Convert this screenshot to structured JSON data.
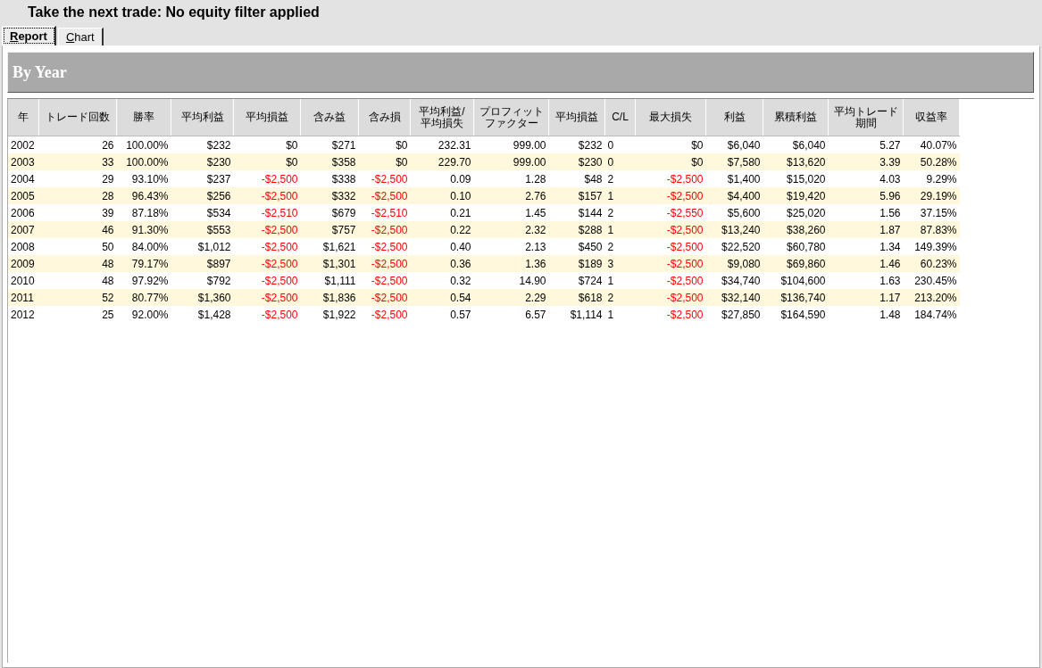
{
  "title": "Take the next trade: No equity filter applied",
  "tabs": [
    {
      "label": "Report",
      "selected": true
    },
    {
      "label": "Chart",
      "selected": false
    }
  ],
  "section_title": "By Year",
  "table": {
    "columns": [
      {
        "label": "年",
        "kind": "text"
      },
      {
        "label": "トレード回数",
        "kind": "number"
      },
      {
        "label": "勝率",
        "kind": "number"
      },
      {
        "label": "平均利益",
        "kind": "number"
      },
      {
        "label": "平均損益",
        "kind": "number"
      },
      {
        "label": "含み益",
        "kind": "number"
      },
      {
        "label": "含み損",
        "kind": "number"
      },
      {
        "label": "平均利益/平均損失",
        "kind": "number"
      },
      {
        "label": "プロフィットファクター",
        "kind": "number"
      },
      {
        "label": "平均損益",
        "kind": "number"
      },
      {
        "label": "C/L",
        "kind": "text"
      },
      {
        "label": "最大損失",
        "kind": "number"
      },
      {
        "label": "利益",
        "kind": "number"
      },
      {
        "label": "累積利益",
        "kind": "number"
      },
      {
        "label": "平均トレード期間",
        "kind": "number"
      },
      {
        "label": "収益率",
        "kind": "number"
      }
    ],
    "rows": [
      {
        "cells": [
          {
            "text": "2002",
            "loss": false
          },
          {
            "text": "26",
            "loss": false
          },
          {
            "text": "100.00%",
            "loss": false
          },
          {
            "text": "$232",
            "loss": false
          },
          {
            "text": "$0",
            "loss": false
          },
          {
            "text": "$271",
            "loss": false
          },
          {
            "text": "$0",
            "loss": false
          },
          {
            "text": "232.31",
            "loss": false
          },
          {
            "text": "999.00",
            "loss": false
          },
          {
            "text": "$232",
            "loss": false
          },
          {
            "text": "0",
            "loss": false
          },
          {
            "text": "$0",
            "loss": false
          },
          {
            "text": "$6,040",
            "loss": false
          },
          {
            "text": "$6,040",
            "loss": false
          },
          {
            "text": "5.27",
            "loss": false
          },
          {
            "text": "40.07%",
            "loss": false
          }
        ]
      },
      {
        "cells": [
          {
            "text": "2003",
            "loss": false
          },
          {
            "text": "33",
            "loss": false
          },
          {
            "text": "100.00%",
            "loss": false
          },
          {
            "text": "$230",
            "loss": false
          },
          {
            "text": "$0",
            "loss": false
          },
          {
            "text": "$358",
            "loss": false
          },
          {
            "text": "$0",
            "loss": false
          },
          {
            "text": "229.70",
            "loss": false
          },
          {
            "text": "999.00",
            "loss": false
          },
          {
            "text": "$230",
            "loss": false
          },
          {
            "text": "0",
            "loss": false
          },
          {
            "text": "$0",
            "loss": false
          },
          {
            "text": "$7,580",
            "loss": false
          },
          {
            "text": "$13,620",
            "loss": false
          },
          {
            "text": "3.39",
            "loss": false
          },
          {
            "text": "50.28%",
            "loss": false
          }
        ]
      },
      {
        "cells": [
          {
            "text": "2004",
            "loss": false
          },
          {
            "text": "29",
            "loss": false
          },
          {
            "text": "93.10%",
            "loss": false
          },
          {
            "text": "$237",
            "loss": false
          },
          {
            "text": "-$2,500",
            "loss": true
          },
          {
            "text": "$338",
            "loss": false
          },
          {
            "text": "-$2,500",
            "loss": true
          },
          {
            "text": "0.09",
            "loss": false
          },
          {
            "text": "1.28",
            "loss": false
          },
          {
            "text": "$48",
            "loss": false
          },
          {
            "text": "2",
            "loss": false
          },
          {
            "text": "-$2,500",
            "loss": true
          },
          {
            "text": "$1,400",
            "loss": false
          },
          {
            "text": "$15,020",
            "loss": false
          },
          {
            "text": "4.03",
            "loss": false
          },
          {
            "text": "9.29%",
            "loss": false
          }
        ]
      },
      {
        "cells": [
          {
            "text": "2005",
            "loss": false
          },
          {
            "text": "28",
            "loss": false
          },
          {
            "text": "96.43%",
            "loss": false
          },
          {
            "text": "$256",
            "loss": false
          },
          {
            "text": "-$2,500",
            "loss": true
          },
          {
            "text": "$332",
            "loss": false
          },
          {
            "text": "-$2,500",
            "loss": true
          },
          {
            "text": "0.10",
            "loss": false
          },
          {
            "text": "2.76",
            "loss": false
          },
          {
            "text": "$157",
            "loss": false
          },
          {
            "text": "1",
            "loss": false
          },
          {
            "text": "-$2,500",
            "loss": true
          },
          {
            "text": "$4,400",
            "loss": false
          },
          {
            "text": "$19,420",
            "loss": false
          },
          {
            "text": "5.96",
            "loss": false
          },
          {
            "text": "29.19%",
            "loss": false
          }
        ]
      },
      {
        "cells": [
          {
            "text": "2006",
            "loss": false
          },
          {
            "text": "39",
            "loss": false
          },
          {
            "text": "87.18%",
            "loss": false
          },
          {
            "text": "$534",
            "loss": false
          },
          {
            "text": "-$2,510",
            "loss": true
          },
          {
            "text": "$679",
            "loss": false
          },
          {
            "text": "-$2,510",
            "loss": true
          },
          {
            "text": "0.21",
            "loss": false
          },
          {
            "text": "1.45",
            "loss": false
          },
          {
            "text": "$144",
            "loss": false
          },
          {
            "text": "2",
            "loss": false
          },
          {
            "text": "-$2,550",
            "loss": true
          },
          {
            "text": "$5,600",
            "loss": false
          },
          {
            "text": "$25,020",
            "loss": false
          },
          {
            "text": "1.56",
            "loss": false
          },
          {
            "text": "37.15%",
            "loss": false
          }
        ]
      },
      {
        "cells": [
          {
            "text": "2007",
            "loss": false
          },
          {
            "text": "46",
            "loss": false
          },
          {
            "text": "91.30%",
            "loss": false
          },
          {
            "text": "$553",
            "loss": false
          },
          {
            "text": "-$2,500",
            "loss": true
          },
          {
            "text": "$757",
            "loss": false
          },
          {
            "text": "-$2,500",
            "loss": true
          },
          {
            "text": "0.22",
            "loss": false
          },
          {
            "text": "2.32",
            "loss": false
          },
          {
            "text": "$288",
            "loss": false
          },
          {
            "text": "1",
            "loss": false
          },
          {
            "text": "-$2,500",
            "loss": true
          },
          {
            "text": "$13,240",
            "loss": false
          },
          {
            "text": "$38,260",
            "loss": false
          },
          {
            "text": "1.87",
            "loss": false
          },
          {
            "text": "87.83%",
            "loss": false
          }
        ]
      },
      {
        "cells": [
          {
            "text": "2008",
            "loss": false
          },
          {
            "text": "50",
            "loss": false
          },
          {
            "text": "84.00%",
            "loss": false
          },
          {
            "text": "$1,012",
            "loss": false
          },
          {
            "text": "-$2,500",
            "loss": true
          },
          {
            "text": "$1,621",
            "loss": false
          },
          {
            "text": "-$2,500",
            "loss": true
          },
          {
            "text": "0.40",
            "loss": false
          },
          {
            "text": "2.13",
            "loss": false
          },
          {
            "text": "$450",
            "loss": false
          },
          {
            "text": "2",
            "loss": false
          },
          {
            "text": "-$2,500",
            "loss": true
          },
          {
            "text": "$22,520",
            "loss": false
          },
          {
            "text": "$60,780",
            "loss": false
          },
          {
            "text": "1.34",
            "loss": false
          },
          {
            "text": "149.39%",
            "loss": false
          }
        ]
      },
      {
        "cells": [
          {
            "text": "2009",
            "loss": false
          },
          {
            "text": "48",
            "loss": false
          },
          {
            "text": "79.17%",
            "loss": false
          },
          {
            "text": "$897",
            "loss": false
          },
          {
            "text": "-$2,500",
            "loss": true
          },
          {
            "text": "$1,301",
            "loss": false
          },
          {
            "text": "-$2,500",
            "loss": true
          },
          {
            "text": "0.36",
            "loss": false
          },
          {
            "text": "1.36",
            "loss": false
          },
          {
            "text": "$189",
            "loss": false
          },
          {
            "text": "3",
            "loss": false
          },
          {
            "text": "-$2,500",
            "loss": true
          },
          {
            "text": "$9,080",
            "loss": false
          },
          {
            "text": "$69,860",
            "loss": false
          },
          {
            "text": "1.46",
            "loss": false
          },
          {
            "text": "60.23%",
            "loss": false
          }
        ]
      },
      {
        "cells": [
          {
            "text": "2010",
            "loss": false
          },
          {
            "text": "48",
            "loss": false
          },
          {
            "text": "97.92%",
            "loss": false
          },
          {
            "text": "$792",
            "loss": false
          },
          {
            "text": "-$2,500",
            "loss": true
          },
          {
            "text": "$1,111",
            "loss": false
          },
          {
            "text": "-$2,500",
            "loss": true
          },
          {
            "text": "0.32",
            "loss": false
          },
          {
            "text": "14.90",
            "loss": false
          },
          {
            "text": "$724",
            "loss": false
          },
          {
            "text": "1",
            "loss": false
          },
          {
            "text": "-$2,500",
            "loss": true
          },
          {
            "text": "$34,740",
            "loss": false
          },
          {
            "text": "$104,600",
            "loss": false
          },
          {
            "text": "1.63",
            "loss": false
          },
          {
            "text": "230.45%",
            "loss": false
          }
        ]
      },
      {
        "cells": [
          {
            "text": "2011",
            "loss": false
          },
          {
            "text": "52",
            "loss": false
          },
          {
            "text": "80.77%",
            "loss": false
          },
          {
            "text": "$1,360",
            "loss": false
          },
          {
            "text": "-$2,500",
            "loss": true
          },
          {
            "text": "$1,836",
            "loss": false
          },
          {
            "text": "-$2,500",
            "loss": true
          },
          {
            "text": "0.54",
            "loss": false
          },
          {
            "text": "2.29",
            "loss": false
          },
          {
            "text": "$618",
            "loss": false
          },
          {
            "text": "2",
            "loss": false
          },
          {
            "text": "-$2,500",
            "loss": true
          },
          {
            "text": "$32,140",
            "loss": false
          },
          {
            "text": "$136,740",
            "loss": false
          },
          {
            "text": "1.17",
            "loss": false
          },
          {
            "text": "213.20%",
            "loss": false
          }
        ]
      },
      {
        "cells": [
          {
            "text": "2012",
            "loss": false
          },
          {
            "text": "25",
            "loss": false
          },
          {
            "text": "92.00%",
            "loss": false
          },
          {
            "text": "$1,428",
            "loss": false
          },
          {
            "text": "-$2,500",
            "loss": true
          },
          {
            "text": "$1,922",
            "loss": false
          },
          {
            "text": "-$2,500",
            "loss": true
          },
          {
            "text": "0.57",
            "loss": false
          },
          {
            "text": "6.57",
            "loss": false
          },
          {
            "text": "$1,114",
            "loss": false
          },
          {
            "text": "1",
            "loss": false
          },
          {
            "text": "-$2,500",
            "loss": true
          },
          {
            "text": "$27,850",
            "loss": false
          },
          {
            "text": "$164,590",
            "loss": false
          },
          {
            "text": "1.48",
            "loss": false
          },
          {
            "text": "184.74%",
            "loss": false
          }
        ]
      }
    ]
  }
}
